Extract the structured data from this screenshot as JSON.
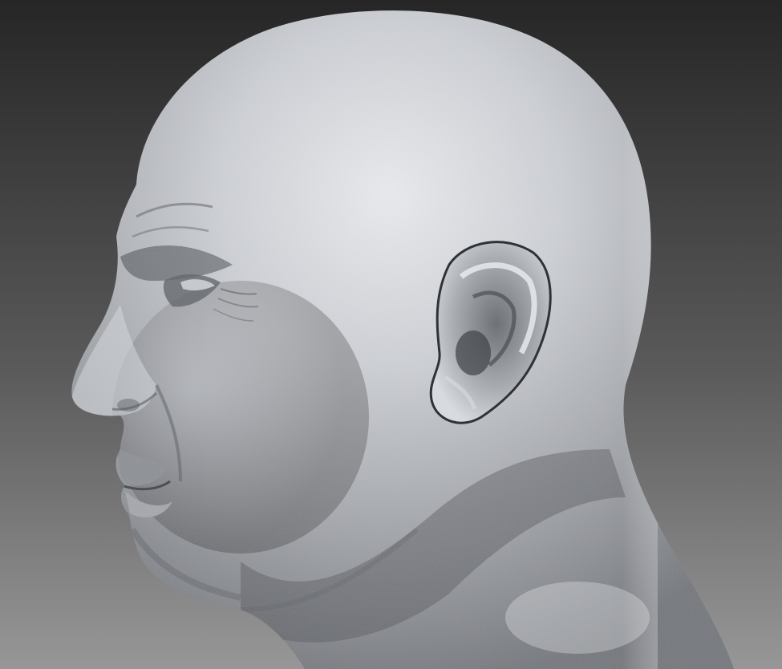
{
  "scene": {
    "subject": "sculpted-head-profile",
    "background_top": "#2a2a2a",
    "background_bottom": "#8c8c8c",
    "material_light": "#e6e8ec",
    "material_mid": "#a9acb1",
    "material_dark": "#5e6166",
    "material_shadow": "#33363a"
  }
}
